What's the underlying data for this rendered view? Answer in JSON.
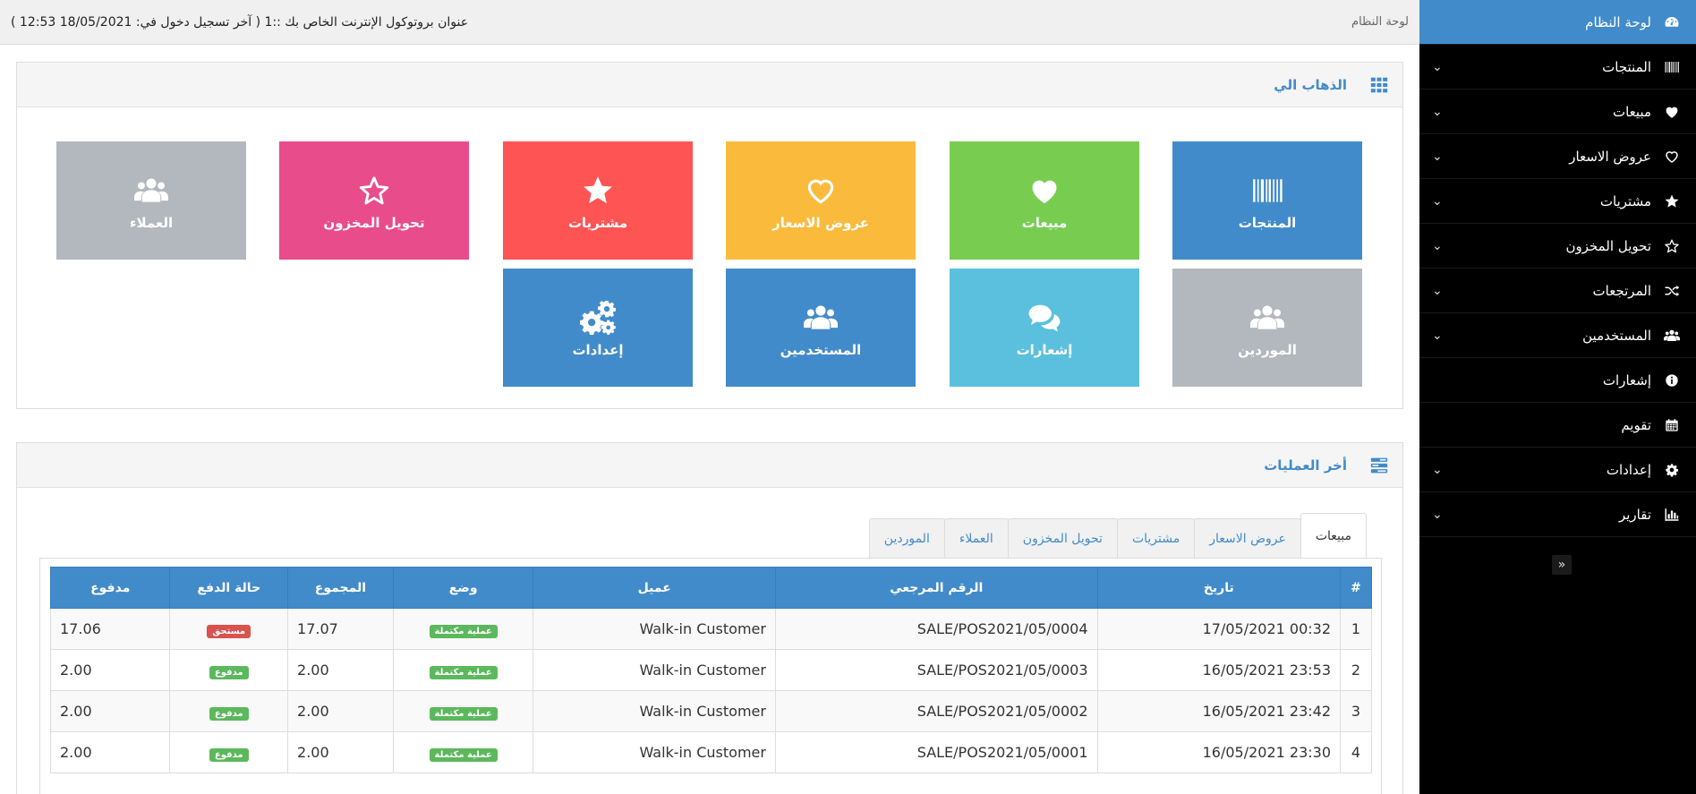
{
  "topbar": {
    "login_info": "عنوان بروتوكول الإنترنت الخاص بك ::1 ( آخر تسجيل دخول في: 18/05/2021 12:53 )",
    "breadcrumb": "لوحة النظام"
  },
  "sidebar": {
    "items": [
      {
        "label": "لوحة النظام",
        "icon": "dashboard-icon",
        "has_chevron": false
      },
      {
        "label": "المنتجات",
        "icon": "barcode-icon",
        "has_chevron": true
      },
      {
        "label": "مبيعات",
        "icon": "heart-icon",
        "has_chevron": true
      },
      {
        "label": "عروض الاسعار",
        "icon": "heart-outline-icon",
        "has_chevron": true
      },
      {
        "label": "مشتريات",
        "icon": "star-icon",
        "has_chevron": true
      },
      {
        "label": "تحويل المخزون",
        "icon": "star-outline-icon",
        "has_chevron": true
      },
      {
        "label": "المرتجعات",
        "icon": "random-icon",
        "has_chevron": true
      },
      {
        "label": "المستخدمين",
        "icon": "users-icon",
        "has_chevron": true
      },
      {
        "label": "إشعارات",
        "icon": "info-icon",
        "has_chevron": false
      },
      {
        "label": "تقويم",
        "icon": "calendar-icon",
        "has_chevron": false
      },
      {
        "label": "إعدادات",
        "icon": "gear-icon",
        "has_chevron": true
      },
      {
        "label": "تقارير",
        "icon": "bar-chart-icon",
        "has_chevron": true
      }
    ],
    "chevron_glyph": "⌄",
    "collapse_glyph": "»"
  },
  "goto_panel": {
    "title": "الذهاب الي",
    "tiles": [
      {
        "label": "المنتجات",
        "color": "#428bca",
        "icon": "barcode-icon"
      },
      {
        "label": "مبيعات",
        "color": "#78cd51",
        "icon": "heart-icon"
      },
      {
        "label": "عروض الاسعار",
        "color": "#fabb3d",
        "icon": "heart-outline-icon"
      },
      {
        "label": "مشتريات",
        "color": "#ff5454",
        "icon": "star-icon"
      },
      {
        "label": "تحويل المخزون",
        "color": "#e84c8a",
        "icon": "star-outline-icon"
      },
      {
        "label": "العملاء",
        "color": "#b2b8bd",
        "icon": "users-icon"
      },
      {
        "label": "الموردين",
        "color": "#b2b8bd",
        "icon": "users-icon"
      },
      {
        "label": "إشعارات",
        "color": "#5bc0de",
        "icon": "comments-icon"
      },
      {
        "label": "المستخدمين",
        "color": "#428bca",
        "icon": "users-icon"
      },
      {
        "label": "إعدادات",
        "color": "#428bca",
        "icon": "gears-icon"
      }
    ]
  },
  "recent_panel": {
    "title": "أخر العمليات",
    "tabs": [
      "مبيعات",
      "عروض الاسعار",
      "مشتريات",
      "تحويل المخزون",
      "العملاء",
      "الموردين"
    ],
    "active_tab": "مبيعات",
    "columns": [
      "#",
      "تاريخ",
      "الرقم المرجعي",
      "عميل",
      "وضع",
      "المجموع",
      "حالة الدفع",
      "مدفوع"
    ],
    "rows": [
      {
        "n": "1",
        "date": "17/05/2021 00:32",
        "ref": "SALE/POS2021/05/0004",
        "customer": "Walk-in Customer",
        "status": "عملية مكتملة",
        "total": "17.07",
        "payment": "مستحق",
        "payment_color": "red",
        "paid": "17.06"
      },
      {
        "n": "2",
        "date": "16/05/2021 23:53",
        "ref": "SALE/POS2021/05/0003",
        "customer": "Walk-in Customer",
        "status": "عملية مكتملة",
        "total": "2.00",
        "payment": "مدفوع",
        "payment_color": "green",
        "paid": "2.00"
      },
      {
        "n": "3",
        "date": "16/05/2021 23:42",
        "ref": "SALE/POS2021/05/0002",
        "customer": "Walk-in Customer",
        "status": "عملية مكتملة",
        "total": "2.00",
        "payment": "مدفوع",
        "payment_color": "green",
        "paid": "2.00"
      },
      {
        "n": "4",
        "date": "16/05/2021 23:30",
        "ref": "SALE/POS2021/05/0001",
        "customer": "Walk-in Customer",
        "status": "عملية مكتملة",
        "total": "2.00",
        "payment": "مدفوع",
        "payment_color": "green",
        "paid": "2.00"
      }
    ]
  }
}
